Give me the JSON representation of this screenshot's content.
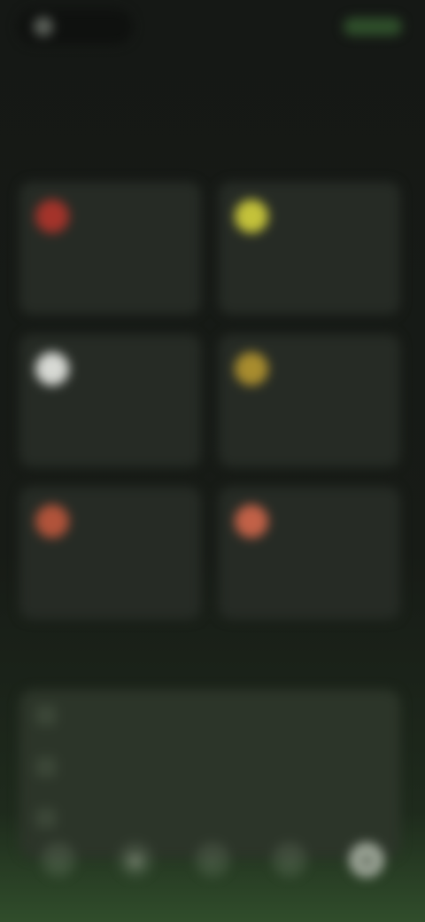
{
  "topbar": {
    "back_label": "",
    "status_label": ""
  },
  "page": {
    "title": ""
  },
  "tiles": [
    {
      "color": "#a4332a",
      "icon": "circle-icon",
      "sub": "",
      "title": ""
    },
    {
      "color": "#c4c23a",
      "icon": "circle-icon",
      "sub": "",
      "title": ""
    },
    {
      "color": "#d7d9d4",
      "icon": "circle-icon",
      "sub": "",
      "title": ""
    },
    {
      "color": "#a88c2e",
      "icon": "circle-icon",
      "sub": "",
      "title": ""
    },
    {
      "color": "#b1533a",
      "icon": "circle-icon",
      "sub": "",
      "title": ""
    },
    {
      "color": "#c26147",
      "icon": "circle-icon",
      "sub": "",
      "title": ""
    }
  ],
  "section": {
    "label": ""
  },
  "list": [
    {
      "icon": "list-icon",
      "label": ""
    },
    {
      "icon": "list-icon",
      "label": ""
    },
    {
      "icon": "list-icon",
      "label": ""
    }
  ],
  "nav": [
    {
      "icon": "home-icon"
    },
    {
      "icon": "grid-icon"
    },
    {
      "icon": "search-icon"
    },
    {
      "icon": "bell-icon"
    },
    {
      "icon": "profile-icon"
    }
  ]
}
